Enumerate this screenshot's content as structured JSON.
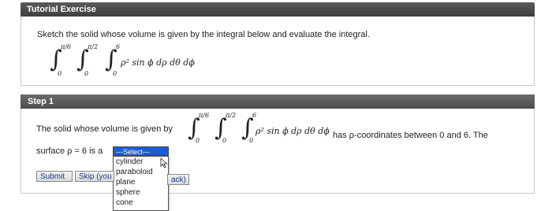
{
  "window": {
    "title": "Tutorial Exercise"
  },
  "problem": {
    "prompt": "Sketch the solid whose volume is given by the integral below and evaluate the integral.",
    "integral": {
      "outer_upper": "π/6",
      "outer_lower": "0",
      "middle_upper": "π/2",
      "middle_lower": "0",
      "inner_upper": "6",
      "inner_lower": "0",
      "integrand": "ρ² sin ϕ dρ dθ dϕ"
    }
  },
  "step": {
    "header": "Step 1",
    "text_before": "The solid whose volume is given by",
    "text_after": "has ρ-coordinates between 0 and 6. The",
    "surface_prefix": "surface ρ = 6 is a",
    "integral": {
      "outer_upper": "π/6",
      "outer_lower": "0",
      "middle_upper": "π/2",
      "middle_lower": "0",
      "inner_upper": "6",
      "inner_lower": "0",
      "integrand": "ρ² sin ϕ dρ dθ dϕ"
    },
    "select": {
      "selected": "---Select---",
      "options": [
        "cylinder",
        "paraboloid",
        "plane",
        "sphere",
        "cone"
      ]
    },
    "buttons": {
      "submit": "Submit",
      "skip": "Skip (you",
      "back": "ack)"
    }
  },
  "colors": {
    "title_bar": "#4a4a4a",
    "select_highlight": "#1e5bd8",
    "button_text": "#1f3c88"
  }
}
